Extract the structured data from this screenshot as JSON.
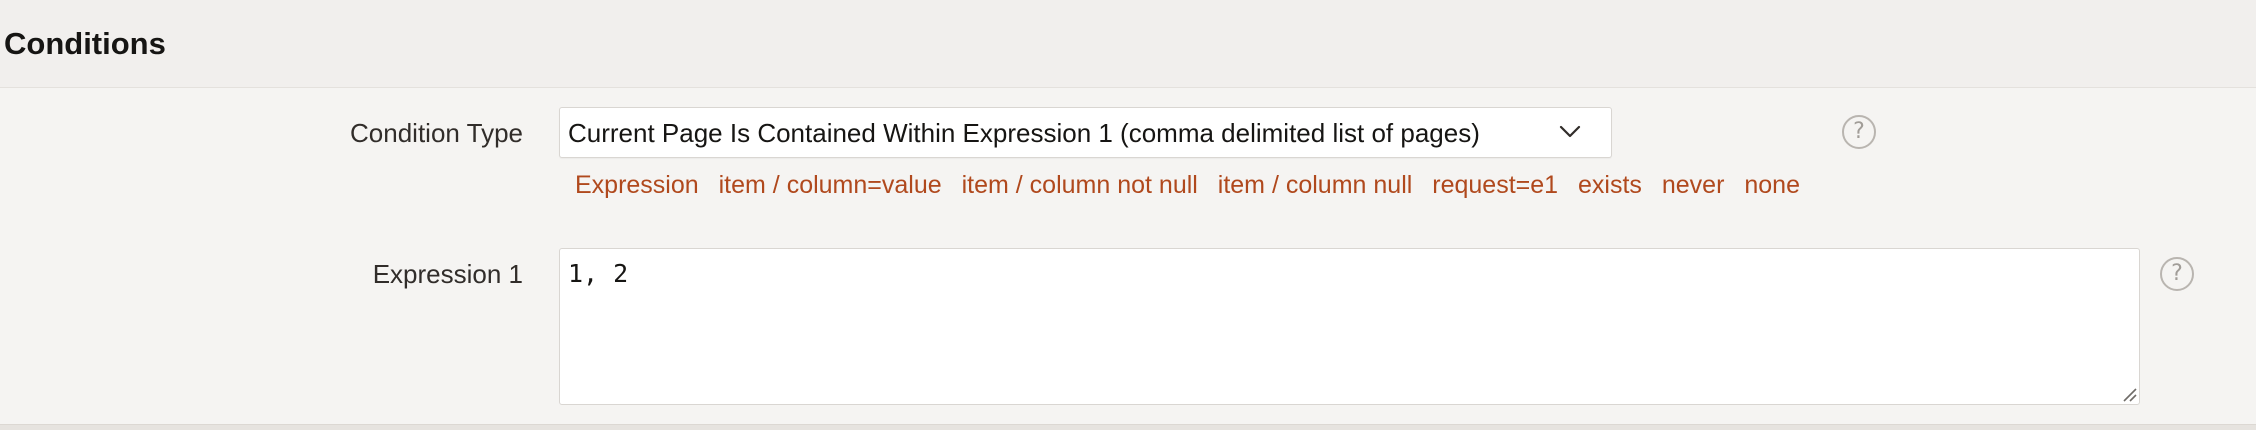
{
  "region": {
    "title": "Conditions"
  },
  "condition_type": {
    "label": "Condition Type",
    "selected_value": "Current Page Is Contained Within Expression 1 (comma delimited list of pages)",
    "help_glyph": "?",
    "shortcuts": [
      "Expression",
      "item / column=value",
      "item / column not null",
      "item / column null",
      "request=e1",
      "exists",
      "never",
      "none"
    ]
  },
  "expression1": {
    "label": "Expression 1",
    "value": "1, 2",
    "help_glyph": "?"
  },
  "colors": {
    "link": "#b0491d",
    "background": "#f5f4f2",
    "header_background": "#f1efed",
    "input_background": "#ffffff",
    "border": "#d9d6d2"
  },
  "icons": {
    "select_chevron": "chevron-down-icon",
    "help": "help-icon",
    "resize": "resize-handle-icon"
  }
}
